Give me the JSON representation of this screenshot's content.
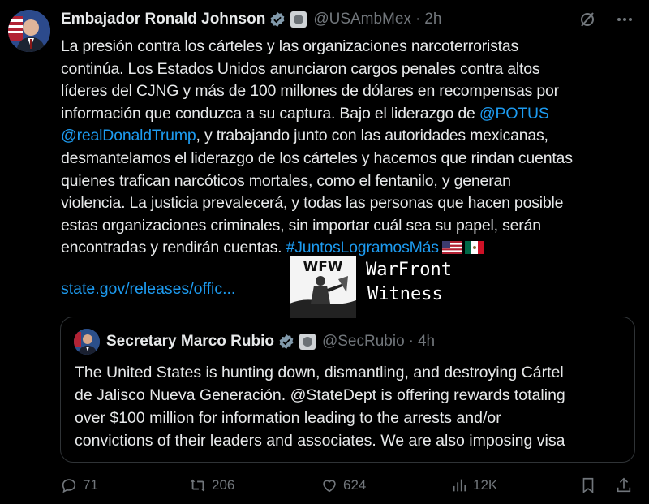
{
  "author": {
    "name": "Embajador Ronald Johnson",
    "handle": "@USAmbMex",
    "separator": "·",
    "time": "2h"
  },
  "tweet": {
    "lines": [
      "La presión contra los cárteles y las organizaciones narcoterroristas",
      "continúa. Los Estados Unidos anunciaron cargos penales contra altos",
      "líderes del CJNG y más de 100 millones de dólares en recompensas por",
      "información que conduzca a su captura. Bajo el liderazgo de ",
      "@POTUS",
      "@realDonaldTrump",
      ", y trabajando junto con las autoridades mexicanas,",
      "desmantelamos el liderazgo de los cárteles y hacemos que rindan cuentas",
      "quienes trafican narcóticos mortales, como el fentanilo, y generan",
      "violencia. La justicia prevalecerá, y todas las personas que hacen posible",
      "estas organizaciones criminales, sin importar cuál sea su papel, serán",
      "encontradas y rendirán cuentas.  ",
      "#JuntosLogramosMás"
    ],
    "link": "state.gov/releases/offic..."
  },
  "watermark": {
    "logo_text": "WFW",
    "line1": "WarFront",
    "line2": "Witness"
  },
  "quoted": {
    "name": "Secretary Marco Rubio",
    "handle": "@SecRubio",
    "separator": "·",
    "time": "4h",
    "lines": [
      "The United States is hunting down, dismantling, and destroying Cártel",
      "de Jalisco Nueva Generación. @StateDept is offering rewards totaling",
      "over $100 million for information leading to the arrests and/or",
      "convictions of their leaders and associates. We are also imposing visa"
    ]
  },
  "actions": {
    "replies": "71",
    "retweets": "206",
    "likes": "624",
    "views": "12K"
  },
  "colors": {
    "background": "#000000",
    "text": "#e7e9ea",
    "muted": "#71767b",
    "link": "#1d9bf0",
    "border": "#2f3336"
  },
  "icons": [
    "grok-icon",
    "more-icon",
    "verified-icon",
    "government-seal-icon",
    "us-flag-icon",
    "mexico-flag-icon",
    "reply-icon",
    "retweet-icon",
    "like-icon",
    "views-icon",
    "bookmark-icon",
    "share-icon"
  ]
}
